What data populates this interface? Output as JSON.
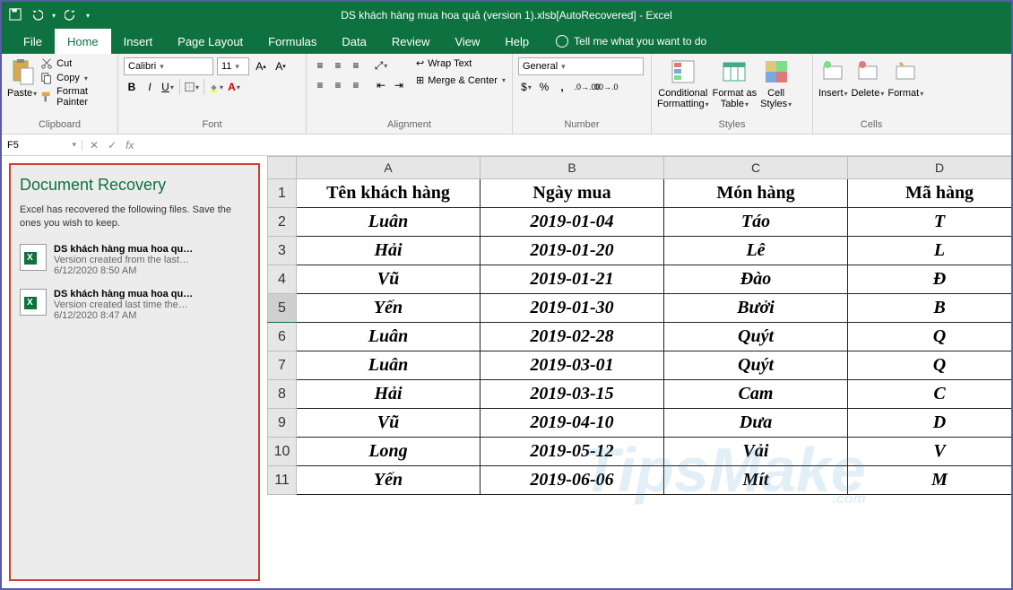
{
  "titlebar": {
    "title": "DS khách hàng mua hoa quả (version 1).xlsb[AutoRecovered]  -  Excel"
  },
  "tabs": [
    "File",
    "Home",
    "Insert",
    "Page Layout",
    "Formulas",
    "Data",
    "Review",
    "View",
    "Help"
  ],
  "tell_me": "Tell me what you want to do",
  "clipboard": {
    "paste": "Paste",
    "cut": "Cut",
    "copy": "Copy",
    "fp": "Format Painter",
    "label": "Clipboard"
  },
  "font": {
    "name": "Calibri",
    "size": "11",
    "label": "Font"
  },
  "alignment": {
    "wrap": "Wrap Text",
    "merge": "Merge & Center",
    "label": "Alignment"
  },
  "number": {
    "format": "General",
    "label": "Number"
  },
  "styles": {
    "cond": "Conditional\nFormatting",
    "fat": "Format as\nTable",
    "cell": "Cell\nStyles",
    "label": "Styles"
  },
  "cells": {
    "insert": "Insert",
    "delete": "Delete",
    "format": "Format",
    "label": "Cells"
  },
  "name_box": "F5",
  "recovery": {
    "title": "Document Recovery",
    "desc": "Excel has recovered the following files.  Save the ones you wish to keep.",
    "items": [
      {
        "name": "DS khách hàng mua hoa qu…",
        "ver": "Version created from the last…",
        "time": "6/12/2020 8:50 AM"
      },
      {
        "name": "DS khách hàng mua hoa qu…",
        "ver": "Version created last time the…",
        "time": "6/12/2020 8:47 AM"
      }
    ]
  },
  "columns": [
    "A",
    "B",
    "C",
    "D"
  ],
  "selected_row": 5,
  "sheet": {
    "headers": [
      "Tên khách hàng",
      "Ngày mua",
      "Món hàng",
      "Mã hàng"
    ],
    "rows": [
      [
        "Luân",
        "2019-01-04",
        "Táo",
        "T"
      ],
      [
        "Hải",
        "2019-01-20",
        "Lê",
        "L"
      ],
      [
        "Vũ",
        "2019-01-21",
        "Đào",
        "Đ"
      ],
      [
        "Yến",
        "2019-01-30",
        "Bưởi",
        "B"
      ],
      [
        "Luân",
        "2019-02-28",
        "Quýt",
        "Q"
      ],
      [
        "Luân",
        "2019-03-01",
        "Quýt",
        "Q"
      ],
      [
        "Hải",
        "2019-03-15",
        "Cam",
        "C"
      ],
      [
        "Vũ",
        "2019-04-10",
        "Dưa",
        "D"
      ],
      [
        "Long",
        "2019-05-12",
        "Vải",
        "V"
      ],
      [
        "Yến",
        "2019-06-06",
        "Mít",
        "M"
      ]
    ]
  },
  "watermark": "TipsMake",
  "watermark_sub": ".com"
}
